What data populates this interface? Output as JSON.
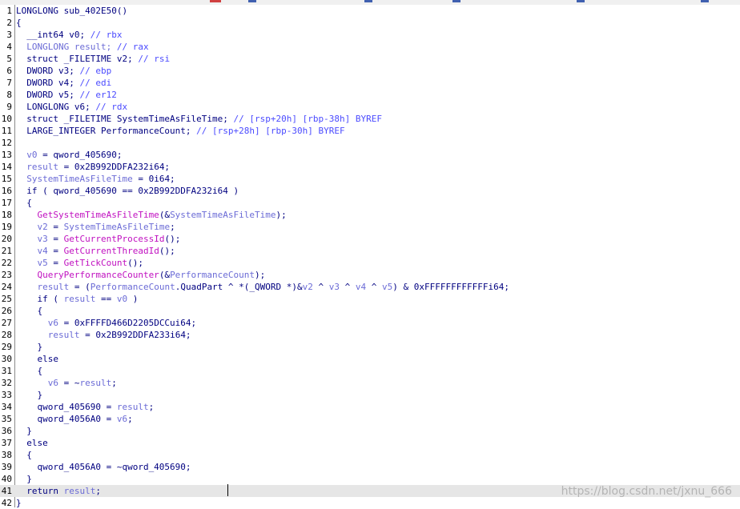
{
  "colors": {
    "text": "#000080",
    "comment": "#4b4bff",
    "local_var": "#6b6bd6",
    "function_call": "#c010c0",
    "highlight": "#e6e6e6"
  },
  "watermark": "https://blog.csdn.net/jxnu_666",
  "lines": [
    {
      "n": "1",
      "segs": [
        {
          "t": "LONGLONG sub_402E50()",
          "c": "kw"
        }
      ]
    },
    {
      "n": "2",
      "segs": [
        {
          "t": "{",
          "c": "kw"
        }
      ]
    },
    {
      "n": "3",
      "segs": [
        {
          "t": "  __int64 v0; ",
          "c": "kw"
        },
        {
          "t": "// rbx",
          "c": "cm"
        }
      ]
    },
    {
      "n": "4",
      "segs": [
        {
          "t": "  LONGLONG result; ",
          "c": "lv"
        },
        {
          "t": "// rax",
          "c": "cm"
        }
      ]
    },
    {
      "n": "5",
      "segs": [
        {
          "t": "  struct _FILETIME v2; ",
          "c": "kw"
        },
        {
          "t": "// rsi",
          "c": "cm"
        }
      ]
    },
    {
      "n": "6",
      "segs": [
        {
          "t": "  DWORD v3; ",
          "c": "kw"
        },
        {
          "t": "// ebp",
          "c": "cm"
        }
      ]
    },
    {
      "n": "7",
      "segs": [
        {
          "t": "  DWORD v4; ",
          "c": "kw"
        },
        {
          "t": "// edi",
          "c": "cm"
        }
      ]
    },
    {
      "n": "8",
      "segs": [
        {
          "t": "  DWORD v5; ",
          "c": "kw"
        },
        {
          "t": "// er12",
          "c": "cm"
        }
      ]
    },
    {
      "n": "9",
      "segs": [
        {
          "t": "  LONGLONG v6; ",
          "c": "kw"
        },
        {
          "t": "// rdx",
          "c": "cm"
        }
      ]
    },
    {
      "n": "10",
      "segs": [
        {
          "t": "  struct _FILETIME SystemTimeAsFileTime; ",
          "c": "kw"
        },
        {
          "t": "// [rsp+20h] [rbp-38h] BYREF",
          "c": "cm"
        }
      ]
    },
    {
      "n": "11",
      "segs": [
        {
          "t": "  LARGE_INTEGER PerformanceCount; ",
          "c": "kw"
        },
        {
          "t": "// [rsp+28h] [rbp-30h] BYREF",
          "c": "cm"
        }
      ]
    },
    {
      "n": "12",
      "segs": [
        {
          "t": "",
          "c": "kw"
        }
      ]
    },
    {
      "n": "13",
      "segs": [
        {
          "t": "  v0",
          "c": "lv"
        },
        {
          "t": " = qword_405690;",
          "c": "kw"
        }
      ]
    },
    {
      "n": "14",
      "segs": [
        {
          "t": "  result",
          "c": "lv"
        },
        {
          "t": " = 0x2B992DDFA232i64;",
          "c": "kw"
        }
      ]
    },
    {
      "n": "15",
      "segs": [
        {
          "t": "  SystemTimeAsFileTime",
          "c": "lv"
        },
        {
          "t": " = 0i64;",
          "c": "kw"
        }
      ]
    },
    {
      "n": "16",
      "segs": [
        {
          "t": "  if ( qword_405690 == 0x2B992DDFA232i64 )",
          "c": "kw"
        }
      ]
    },
    {
      "n": "17",
      "segs": [
        {
          "t": "  {",
          "c": "kw"
        }
      ]
    },
    {
      "n": "18",
      "segs": [
        {
          "t": "    GetSystemTimeAsFileTime",
          "c": "fn"
        },
        {
          "t": "(&",
          "c": "kw"
        },
        {
          "t": "SystemTimeAsFileTime",
          "c": "lv"
        },
        {
          "t": ");",
          "c": "kw"
        }
      ]
    },
    {
      "n": "19",
      "segs": [
        {
          "t": "    v2",
          "c": "lv"
        },
        {
          "t": " = ",
          "c": "kw"
        },
        {
          "t": "SystemTimeAsFileTime",
          "c": "lv"
        },
        {
          "t": ";",
          "c": "kw"
        }
      ]
    },
    {
      "n": "20",
      "segs": [
        {
          "t": "    v3",
          "c": "lv"
        },
        {
          "t": " = ",
          "c": "kw"
        },
        {
          "t": "GetCurrentProcessId",
          "c": "fn"
        },
        {
          "t": "();",
          "c": "kw"
        }
      ]
    },
    {
      "n": "21",
      "segs": [
        {
          "t": "    v4",
          "c": "lv"
        },
        {
          "t": " = ",
          "c": "kw"
        },
        {
          "t": "GetCurrentThreadId",
          "c": "fn"
        },
        {
          "t": "();",
          "c": "kw"
        }
      ]
    },
    {
      "n": "22",
      "segs": [
        {
          "t": "    v5",
          "c": "lv"
        },
        {
          "t": " = ",
          "c": "kw"
        },
        {
          "t": "GetTickCount",
          "c": "fn"
        },
        {
          "t": "();",
          "c": "kw"
        }
      ]
    },
    {
      "n": "23",
      "segs": [
        {
          "t": "    QueryPerformanceCounter",
          "c": "fn"
        },
        {
          "t": "(&",
          "c": "kw"
        },
        {
          "t": "PerformanceCount",
          "c": "lv"
        },
        {
          "t": ");",
          "c": "kw"
        }
      ]
    },
    {
      "n": "24",
      "segs": [
        {
          "t": "    result",
          "c": "lv"
        },
        {
          "t": " = (",
          "c": "kw"
        },
        {
          "t": "PerformanceCount",
          "c": "lv"
        },
        {
          "t": ".QuadPart ^ *(_QWORD *)&",
          "c": "kw"
        },
        {
          "t": "v2",
          "c": "lv"
        },
        {
          "t": " ^ ",
          "c": "kw"
        },
        {
          "t": "v3",
          "c": "lv"
        },
        {
          "t": " ^ ",
          "c": "kw"
        },
        {
          "t": "v4",
          "c": "lv"
        },
        {
          "t": " ^ ",
          "c": "kw"
        },
        {
          "t": "v5",
          "c": "lv"
        },
        {
          "t": ") & 0xFFFFFFFFFFFFi64;",
          "c": "kw"
        }
      ]
    },
    {
      "n": "25",
      "segs": [
        {
          "t": "    if ( ",
          "c": "kw"
        },
        {
          "t": "result",
          "c": "lv"
        },
        {
          "t": " == ",
          "c": "kw"
        },
        {
          "t": "v0",
          "c": "lv"
        },
        {
          "t": " )",
          "c": "kw"
        }
      ]
    },
    {
      "n": "26",
      "segs": [
        {
          "t": "    {",
          "c": "kw"
        }
      ]
    },
    {
      "n": "27",
      "segs": [
        {
          "t": "      v6",
          "c": "lv"
        },
        {
          "t": " = 0xFFFFD466D2205DCCui64;",
          "c": "kw"
        }
      ]
    },
    {
      "n": "28",
      "segs": [
        {
          "t": "      result",
          "c": "lv"
        },
        {
          "t": " = 0x2B992DDFA233i64;",
          "c": "kw"
        }
      ]
    },
    {
      "n": "29",
      "segs": [
        {
          "t": "    }",
          "c": "kw"
        }
      ]
    },
    {
      "n": "30",
      "segs": [
        {
          "t": "    else",
          "c": "kw"
        }
      ]
    },
    {
      "n": "31",
      "segs": [
        {
          "t": "    {",
          "c": "kw"
        }
      ]
    },
    {
      "n": "32",
      "segs": [
        {
          "t": "      v6",
          "c": "lv"
        },
        {
          "t": " = ~",
          "c": "kw"
        },
        {
          "t": "result",
          "c": "lv"
        },
        {
          "t": ";",
          "c": "kw"
        }
      ]
    },
    {
      "n": "33",
      "segs": [
        {
          "t": "    }",
          "c": "kw"
        }
      ]
    },
    {
      "n": "34",
      "segs": [
        {
          "t": "    qword_405690 = ",
          "c": "kw"
        },
        {
          "t": "result",
          "c": "lv"
        },
        {
          "t": ";",
          "c": "kw"
        }
      ]
    },
    {
      "n": "35",
      "segs": [
        {
          "t": "    qword_4056A0 = ",
          "c": "kw"
        },
        {
          "t": "v6",
          "c": "lv"
        },
        {
          "t": ";",
          "c": "kw"
        }
      ]
    },
    {
      "n": "36",
      "segs": [
        {
          "t": "  }",
          "c": "kw"
        }
      ]
    },
    {
      "n": "37",
      "segs": [
        {
          "t": "  else",
          "c": "kw"
        }
      ]
    },
    {
      "n": "38",
      "segs": [
        {
          "t": "  {",
          "c": "kw"
        }
      ]
    },
    {
      "n": "39",
      "segs": [
        {
          "t": "    qword_4056A0 = ~qword_405690;",
          "c": "kw"
        }
      ]
    },
    {
      "n": "40",
      "segs": [
        {
          "t": "  }",
          "c": "kw"
        }
      ]
    },
    {
      "n": "41",
      "segs": [
        {
          "t": "  return ",
          "c": "kw"
        },
        {
          "t": "result",
          "c": "lv"
        },
        {
          "t": ";",
          "c": "kw"
        }
      ],
      "highlight": true
    },
    {
      "n": "42",
      "segs": [
        {
          "t": "}",
          "c": "kw"
        }
      ]
    }
  ]
}
